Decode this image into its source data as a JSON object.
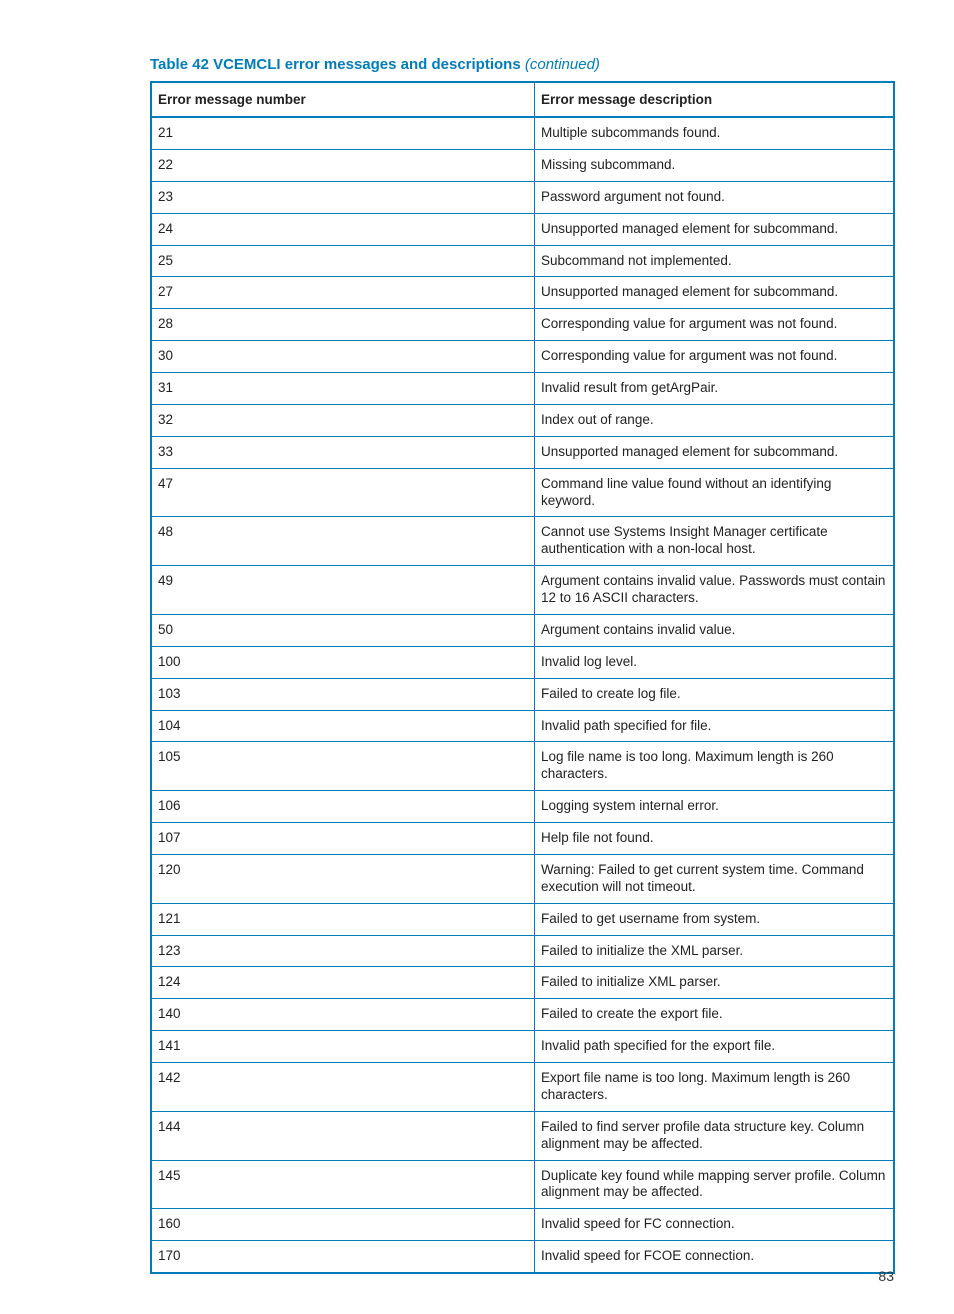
{
  "title": {
    "label": "Table 42 VCEMCLI error messages and descriptions",
    "continued": "(continued)"
  },
  "columns": {
    "num": "Error message number",
    "desc": "Error message description"
  },
  "rows": [
    {
      "num": "21",
      "desc": "Multiple subcommands found."
    },
    {
      "num": "22",
      "desc": "Missing subcommand."
    },
    {
      "num": "23",
      "desc": "Password argument not found."
    },
    {
      "num": "24",
      "desc": "Unsupported managed element for subcommand."
    },
    {
      "num": "25",
      "desc": "Subcommand not implemented."
    },
    {
      "num": "27",
      "desc": "Unsupported managed element for subcommand."
    },
    {
      "num": "28",
      "desc": "Corresponding value for argument was not found."
    },
    {
      "num": "30",
      "desc": "Corresponding value for argument was not found."
    },
    {
      "num": "31",
      "desc": "Invalid result from getArgPair."
    },
    {
      "num": "32",
      "desc": "Index out of range."
    },
    {
      "num": "33",
      "desc": "Unsupported managed element for subcommand."
    },
    {
      "num": "47",
      "desc": "Command line value found without an identifying keyword."
    },
    {
      "num": "48",
      "desc": "Cannot use Systems Insight Manager certificate authentication with a non-local host."
    },
    {
      "num": "49",
      "desc": "Argument contains invalid value. Passwords must contain 12 to 16 ASCII characters."
    },
    {
      "num": "50",
      "desc": "Argument contains invalid value."
    },
    {
      "num": "100",
      "desc": "Invalid log level."
    },
    {
      "num": "103",
      "desc": "Failed to create log file."
    },
    {
      "num": "104",
      "desc": "Invalid path specified for file."
    },
    {
      "num": "105",
      "desc": "Log file name is too long. Maximum length is 260 characters."
    },
    {
      "num": "106",
      "desc": "Logging system internal error."
    },
    {
      "num": "107",
      "desc": "Help file not found."
    },
    {
      "num": "120",
      "desc": "Warning: Failed to get current system time. Command execution will not timeout."
    },
    {
      "num": "121",
      "desc": "Failed to get username from system."
    },
    {
      "num": "123",
      "desc": "Failed to initialize the XML parser."
    },
    {
      "num": "124",
      "desc": "Failed to initialize XML parser."
    },
    {
      "num": "140",
      "desc": "Failed to create the export file."
    },
    {
      "num": "141",
      "desc": "Invalid path specified for the export file."
    },
    {
      "num": "142",
      "desc": "Export file name is too long. Maximum length is 260 characters."
    },
    {
      "num": "144",
      "desc": "Failed to find server profile data structure key. Column alignment may be affected."
    },
    {
      "num": "145",
      "desc": "Duplicate key found while mapping server profile. Column alignment may be affected."
    },
    {
      "num": "160",
      "desc": "Invalid speed for FC connection."
    },
    {
      "num": "170",
      "desc": "Invalid speed for FCOE connection."
    }
  ],
  "page_number": "83"
}
